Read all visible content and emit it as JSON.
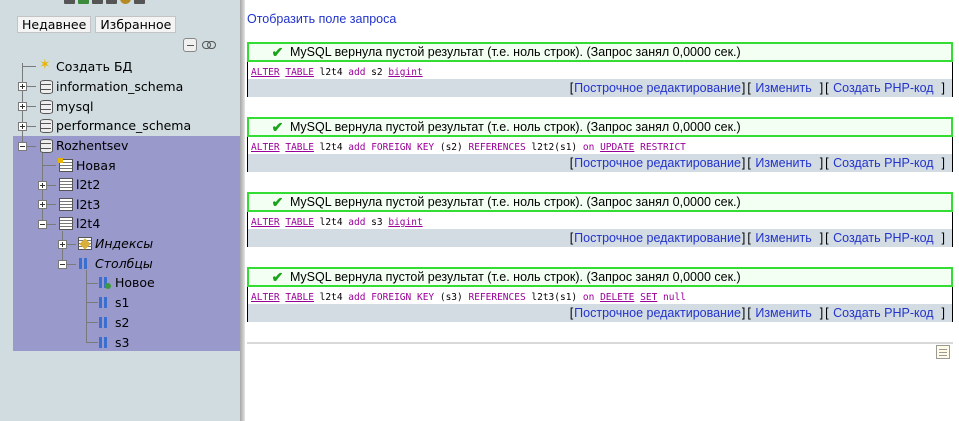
{
  "nav": {
    "tabs": [
      "Недавнее",
      "Избранное"
    ],
    "tree": [
      {
        "label": "Создать БД",
        "icon": "new-db-icon"
      },
      {
        "label": "information_schema",
        "icon": "database-icon"
      },
      {
        "label": "mysql",
        "icon": "database-icon"
      },
      {
        "label": "performance_schema",
        "icon": "database-icon"
      },
      {
        "label": "Rozhentsev",
        "icon": "database-icon"
      },
      {
        "label": "Новая",
        "icon": "new-table-icon"
      },
      {
        "label": "l2t2",
        "icon": "table-icon"
      },
      {
        "label": "l2t3",
        "icon": "table-icon"
      },
      {
        "label": "l2t4",
        "icon": "table-icon"
      },
      {
        "label": "Индексы",
        "icon": "indexes-icon"
      },
      {
        "label": "Столбцы",
        "icon": "columns-icon"
      },
      {
        "label": "Новое",
        "icon": "new-column-icon"
      },
      {
        "label": "s1",
        "icon": "column-icon"
      },
      {
        "label": "s2",
        "icon": "column-icon"
      },
      {
        "label": "s3",
        "icon": "column-icon"
      }
    ]
  },
  "main": {
    "show_query_link": "Отобразить поле запроса",
    "results": [
      {
        "message": "MySQL вернула пустой результат (т.е. ноль строк). (Запрос занял 0,0000 сек.)",
        "sql": [
          {
            "t": "ALTER",
            "c": "kwu"
          },
          {
            "t": " "
          },
          {
            "t": "TABLE",
            "c": "kwu"
          },
          {
            "t": " l2t4 "
          },
          {
            "t": "add",
            "c": "kw"
          },
          {
            "t": " s2 "
          },
          {
            "t": "bigint",
            "c": "tp"
          }
        ]
      },
      {
        "message": "MySQL вернула пустой результат (т.е. ноль строк). (Запрос занял 0,0000 сек.)",
        "sql": [
          {
            "t": "ALTER",
            "c": "kwu"
          },
          {
            "t": " "
          },
          {
            "t": "TABLE",
            "c": "kwu"
          },
          {
            "t": " l2t4 "
          },
          {
            "t": "add",
            "c": "kw"
          },
          {
            "t": " "
          },
          {
            "t": "FOREIGN",
            "c": "kw"
          },
          {
            "t": " "
          },
          {
            "t": "KEY",
            "c": "kw"
          },
          {
            "t": " (s2) "
          },
          {
            "t": "REFERENCES",
            "c": "kw"
          },
          {
            "t": " l2t2(s1) "
          },
          {
            "t": "on",
            "c": "kw"
          },
          {
            "t": " "
          },
          {
            "t": "UPDATE",
            "c": "kwu"
          },
          {
            "t": " "
          },
          {
            "t": "RESTRICT",
            "c": "kw"
          }
        ]
      },
      {
        "message": "MySQL вернула пустой результат (т.е. ноль строк). (Запрос занял 0,0000 сек.)",
        "sql": [
          {
            "t": "ALTER",
            "c": "kwu"
          },
          {
            "t": " "
          },
          {
            "t": "TABLE",
            "c": "kwu"
          },
          {
            "t": " l2t4 "
          },
          {
            "t": "add",
            "c": "kw"
          },
          {
            "t": " s3 "
          },
          {
            "t": "bigint",
            "c": "tp"
          }
        ]
      },
      {
        "message": "MySQL вернула пустой результат (т.е. ноль строк). (Запрос занял 0,0000 сек.)",
        "sql": [
          {
            "t": "ALTER",
            "c": "kwu"
          },
          {
            "t": " "
          },
          {
            "t": "TABLE",
            "c": "kwu"
          },
          {
            "t": " l2t4 "
          },
          {
            "t": "add",
            "c": "kw"
          },
          {
            "t": " "
          },
          {
            "t": "FOREIGN",
            "c": "kw"
          },
          {
            "t": " "
          },
          {
            "t": "KEY",
            "c": "kw"
          },
          {
            "t": " (s3) "
          },
          {
            "t": "REFERENCES",
            "c": "kw"
          },
          {
            "t": " l2t3(s1) "
          },
          {
            "t": "on",
            "c": "kw"
          },
          {
            "t": " "
          },
          {
            "t": "DELETE",
            "c": "kwu"
          },
          {
            "t": " "
          },
          {
            "t": "SET",
            "c": "kwu"
          },
          {
            "t": " "
          },
          {
            "t": "null",
            "c": "kw"
          }
        ]
      }
    ],
    "actions": {
      "inline_edit": "Построчное редактирование",
      "edit": "Изменить",
      "create_php": "Создать PHP-код",
      "open_bracket": "[",
      "close_bracket": "]"
    }
  }
}
